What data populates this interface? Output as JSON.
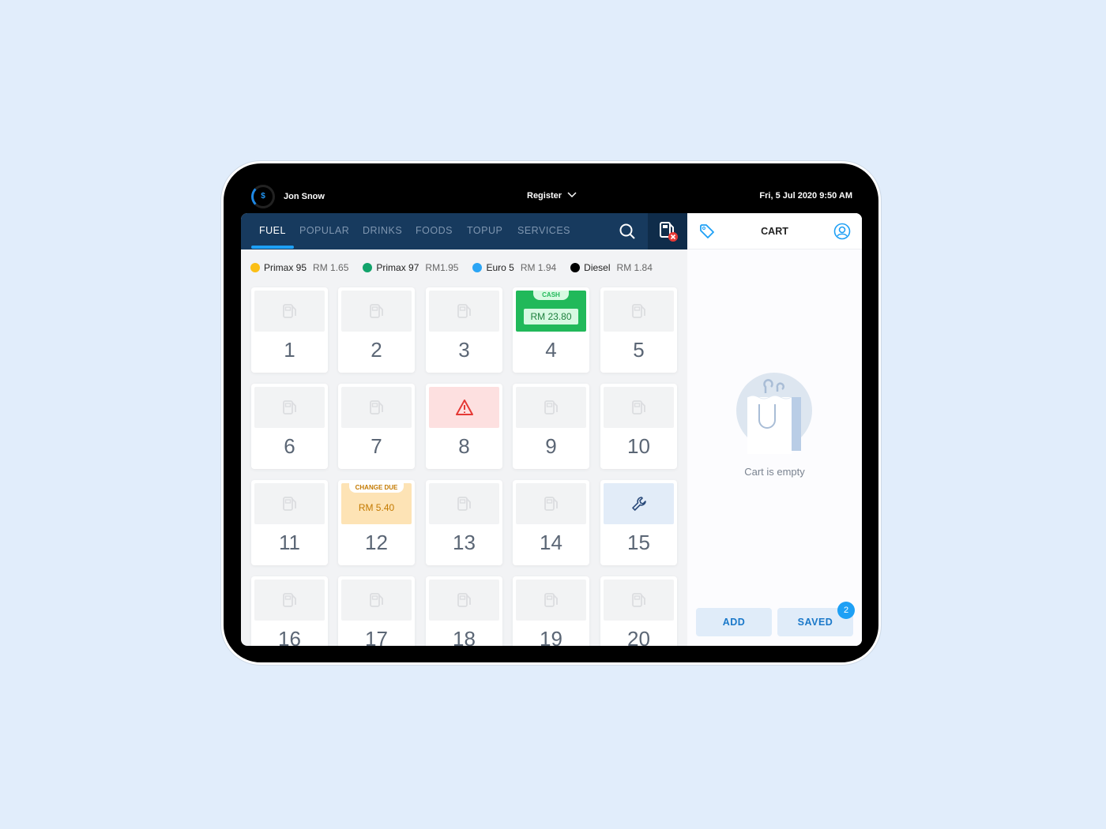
{
  "header": {
    "user": "Jon Snow",
    "register": "Register",
    "datetime": "Fri, 5 Jul 2020  9:50 AM",
    "logo_symbol": "$"
  },
  "nav": {
    "tabs": [
      {
        "label": "FUEL",
        "active": true
      },
      {
        "label": "POPULAR"
      },
      {
        "label": "DRINKS"
      },
      {
        "label": "FOODS"
      },
      {
        "label": "TOPUP"
      },
      {
        "label": "SERVICES"
      }
    ]
  },
  "fuels": [
    {
      "name": "Primax 95",
      "price": "RM 1.65",
      "color": "#fbbf16"
    },
    {
      "name": "Primax 97",
      "price": "RM1.95",
      "color": "#12a36b"
    },
    {
      "name": "Euro 5",
      "price": "RM 1.94",
      "color": "#2ba5f5"
    },
    {
      "name": "Diesel",
      "price": "RM 1.84",
      "color": "#000000"
    }
  ],
  "pumps": [
    {
      "n": "1"
    },
    {
      "n": "2"
    },
    {
      "n": "3"
    },
    {
      "n": "4",
      "state": "cash",
      "label": "CASH",
      "amount": "RM 23.80"
    },
    {
      "n": "5"
    },
    {
      "n": "6"
    },
    {
      "n": "7"
    },
    {
      "n": "8",
      "state": "alert"
    },
    {
      "n": "9"
    },
    {
      "n": "10"
    },
    {
      "n": "11"
    },
    {
      "n": "12",
      "state": "change",
      "label": "CHANGE DUE",
      "amount": "RM 5.40"
    },
    {
      "n": "13"
    },
    {
      "n": "14"
    },
    {
      "n": "15",
      "state": "maintenance"
    },
    {
      "n": "16"
    },
    {
      "n": "17"
    },
    {
      "n": "18"
    },
    {
      "n": "19"
    },
    {
      "n": "20"
    }
  ],
  "cart": {
    "title": "CART",
    "empty": "Cart is empty",
    "add": "ADD",
    "saved": "SAVED",
    "saved_count": "2"
  }
}
